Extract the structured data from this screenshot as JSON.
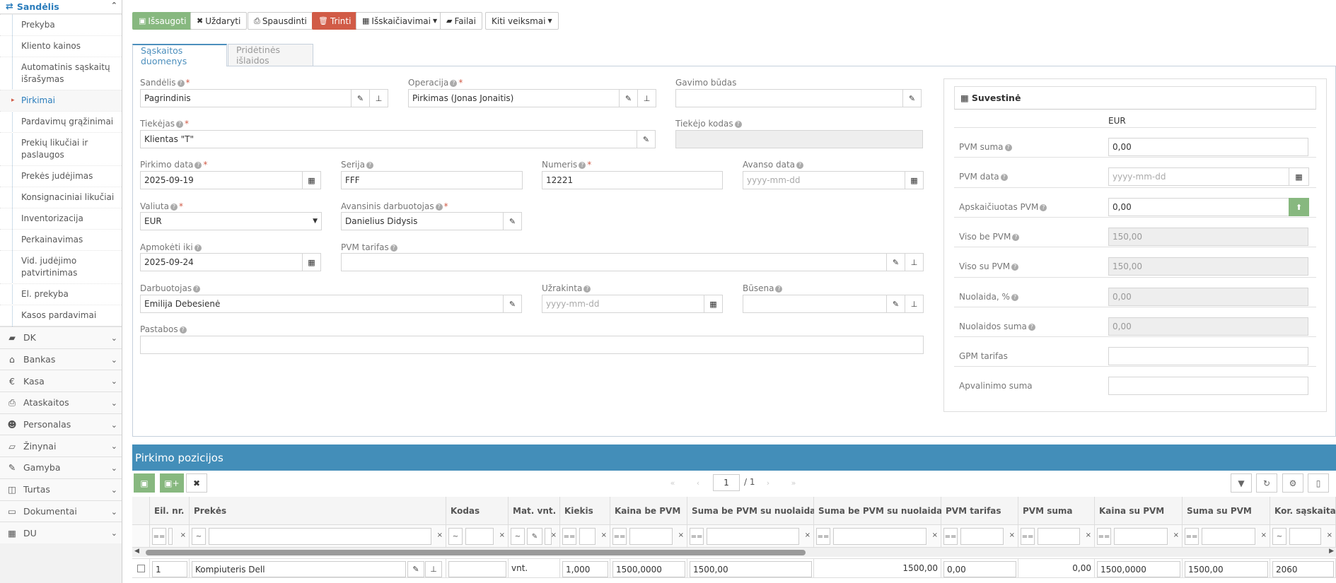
{
  "sidebar": {
    "section_title": "Sandėlis",
    "items": [
      "Prekyba",
      "Kliento kainos",
      "Automatinis sąskaitų išrašymas",
      "Pirkimai",
      "Pardavimų grąžinimai",
      "Prekių likučiai ir paslaugos",
      "Prekės judėjimas",
      "Konsignaciniai likučiai",
      "Inventorizacija",
      "Perkainavimas",
      "Vid. judėjimo patvirtinimas",
      "El. prekyba",
      "Kasos pardavimai"
    ],
    "active_item": "Pirkimai",
    "main_items": [
      "DK",
      "Bankas",
      "Kasa",
      "Ataskaitos",
      "Personalas",
      "Žinynai",
      "Gamyba",
      "Turtas",
      "Dokumentai",
      "DU"
    ]
  },
  "toolbar": {
    "save": "Išsaugoti",
    "close": "Uždaryti",
    "print": "Spausdinti",
    "delete": "Trinti",
    "calc": "Išskaičiavimai",
    "files": "Failai",
    "other": "Kiti veiksmai"
  },
  "tabs": {
    "invoice": "Sąskaitos duomenys",
    "extra": "Pridėtinės išlaidos"
  },
  "form": {
    "warehouse_label": "Sandėlis",
    "warehouse": "Pagrindinis",
    "operation_label": "Operacija",
    "operation": "Pirkimas (Jonas Jonaitis)",
    "receipt_label": "Gavimo būdas",
    "receipt": "",
    "supplier_label": "Tiekėjas",
    "supplier": "Klientas \"T\"",
    "supplier_code_label": "Tiekėjo kodas",
    "supplier_code": "",
    "date_label": "Pirkimo data",
    "date": "2025-09-19",
    "series_label": "Serija",
    "series": "FFF",
    "number_label": "Numeris",
    "number": "12221",
    "advance_date_label": "Avanso data",
    "advance_date_ph": "yyyy-mm-dd",
    "currency_label": "Valiuta",
    "currency": "EUR",
    "advance_emp_label": "Avansinis darbuotojas",
    "advance_emp": "Danielius Didysis",
    "pay_until_label": "Apmokėti iki",
    "pay_until": "2025-09-24",
    "vat_rate_label": "PVM tarifas",
    "vat_rate": "",
    "employee_label": "Darbuotojas",
    "employee": "Emilija Debesienė",
    "locked_label": "Užrakinta",
    "locked_ph": "yyyy-mm-dd",
    "status_label": "Būsena",
    "status": "",
    "notes_label": "Pastabos",
    "notes": ""
  },
  "summary": {
    "title": "Suvestinė",
    "currency": "EUR",
    "rows": [
      {
        "label": "PVM suma",
        "value": "0,00"
      },
      {
        "label": "PVM data",
        "value": "yyyy-mm-dd"
      },
      {
        "label": "Apskaičiuotas PVM",
        "value": "0,00"
      },
      {
        "label": "Viso be PVM",
        "value": "150,00"
      },
      {
        "label": "Viso su PVM",
        "value": "150,00"
      },
      {
        "label": "Nuolaida, %",
        "value": "0,00"
      },
      {
        "label": "Nuolaidos suma",
        "value": "0,00"
      },
      {
        "label": "GPM tarifas",
        "value": ""
      },
      {
        "label": "Apvalinimo suma",
        "value": ""
      }
    ]
  },
  "grid": {
    "title": "Pirkimo pozicijos",
    "page": "1",
    "pages": "/ 1",
    "columns": [
      "Eil. nr.",
      "Prekės",
      "Kodas",
      "Mat. vnt.",
      "Kiekis",
      "Kaina be PVM",
      "Suma be PVM su nuolaida",
      "Suma be PVM su nuolaida, €",
      "PVM tarifas",
      "PVM suma",
      "Kaina su PVM",
      "Suma su PVM",
      "Kor. sąskaita"
    ],
    "filter_ops": [
      "==",
      "~",
      "~",
      "~",
      "==",
      "==",
      "==",
      "==",
      "==",
      "==",
      "==",
      "==",
      "~"
    ],
    "row": {
      "nr": "1",
      "item": "Kompiuteris Dell",
      "code": "",
      "unit": "vnt.",
      "qty": "1,000",
      "price": "1500,0000",
      "sum": "1500,00",
      "sum_eur": "1500,00",
      "vat_rate": "0,00",
      "vat_sum": "0,00",
      "price_vat": "1500,0000",
      "sum_vat": "1500,00",
      "account": "2060"
    }
  }
}
